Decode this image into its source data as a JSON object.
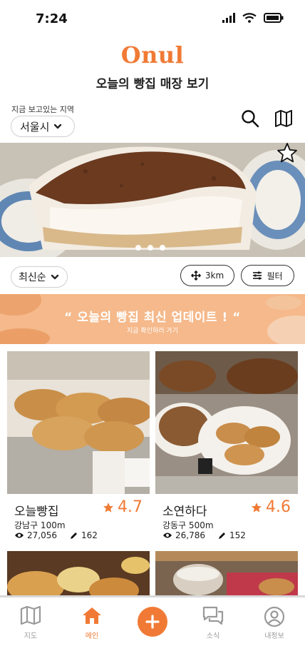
{
  "status": {
    "time": "7:24"
  },
  "header": {
    "logo": "Onul",
    "title": "오늘의 빵집 매장 보기"
  },
  "region": {
    "caption": "지금 보고있는 지역",
    "value": "서울시"
  },
  "hero": {
    "slide_count": 3,
    "active_slide": 1
  },
  "filters": {
    "sort": "최신순",
    "distance": "3km",
    "filter_label": "필터"
  },
  "banner": {
    "title": "“ 오늘의 빵집 최신 업데이트 ! “",
    "subtitle": "지금 확인하러 가기"
  },
  "stores": [
    {
      "name": "오늘빵집",
      "rating": "4.7",
      "location": "강남구 100m",
      "views": "27,056",
      "posts": "162"
    },
    {
      "name": "소연하다",
      "rating": "4.6",
      "location": "강동구 500m",
      "views": "26,786",
      "posts": "152"
    }
  ],
  "nav": {
    "items": [
      {
        "label": "지도",
        "icon": "map-icon"
      },
      {
        "label": "메인",
        "icon": "home-icon"
      },
      {
        "label": "",
        "icon": "plus-icon"
      },
      {
        "label": "소식",
        "icon": "chat-icon"
      },
      {
        "label": "내정보",
        "icon": "user-icon"
      }
    ]
  },
  "colors": {
    "accent": "#f07a35",
    "banner": "#f5b98b",
    "muted": "#9a9a9a"
  }
}
